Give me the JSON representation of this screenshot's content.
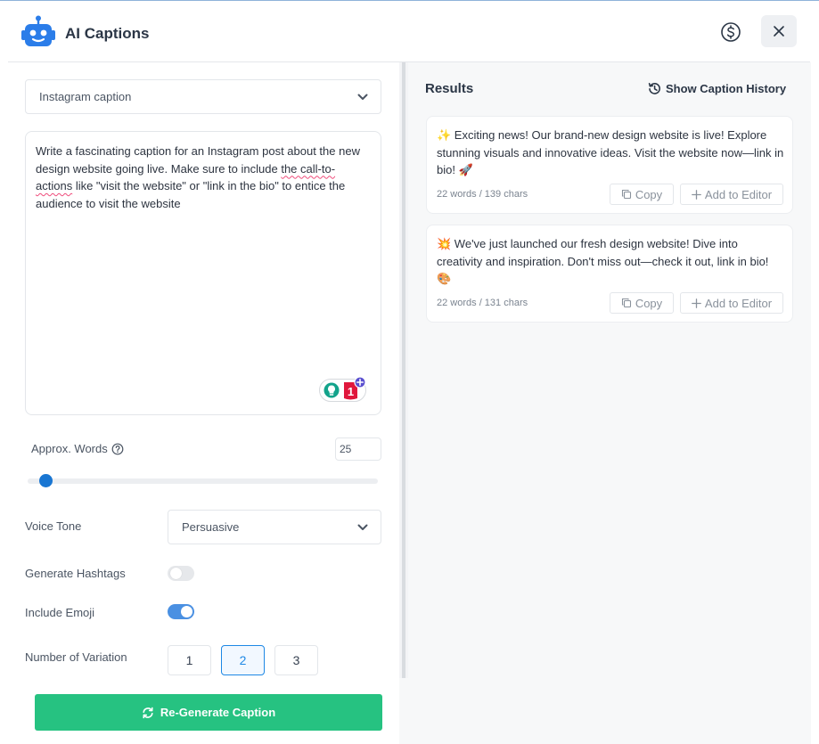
{
  "header": {
    "title": "AI Captions"
  },
  "form": {
    "caption_type": "Instagram caption",
    "prompt_parts": {
      "before": "Write a fascinating caption for an Instagram post about the new design website going live. Make sure to include ",
      "flagged": "the call-to-actions",
      "after": " like \"visit the website\" or \"link in the bio\" to entice the audience to visit the website"
    },
    "grammar_badge_count": "1",
    "approx_words_label": "Approx. Words",
    "approx_words_value": "25",
    "voice_tone_label": "Voice Tone",
    "voice_tone_value": "Persuasive",
    "hashtags_label": "Generate Hashtags",
    "hashtags_enabled": false,
    "emoji_label": "Include Emoji",
    "emoji_enabled": true,
    "variation_label": "Number of Variation",
    "variation_options": [
      "1",
      "2",
      "3"
    ],
    "variation_selected": "2",
    "regenerate_label": "Re-Generate Caption"
  },
  "results": {
    "title": "Results",
    "history_label": "Show Caption History",
    "copy_label": "Copy",
    "add_label": "Add to Editor",
    "items": [
      {
        "text": "✨ Exciting news! Our brand-new design website is live! Explore stunning visuals and innovative ideas. Visit the website now—link in bio! 🚀",
        "stats": "22 words / 139 chars"
      },
      {
        "text": "💥 We've just launched our fresh design website! Dive into creativity and inspiration. Don't miss out—check it out, link in bio! 🎨",
        "stats": "22 words / 131 chars"
      }
    ]
  },
  "colors": {
    "accent_blue": "#1e88e5",
    "primary_green": "#26c281",
    "spellcheck_underline": "#ef4c7b"
  }
}
